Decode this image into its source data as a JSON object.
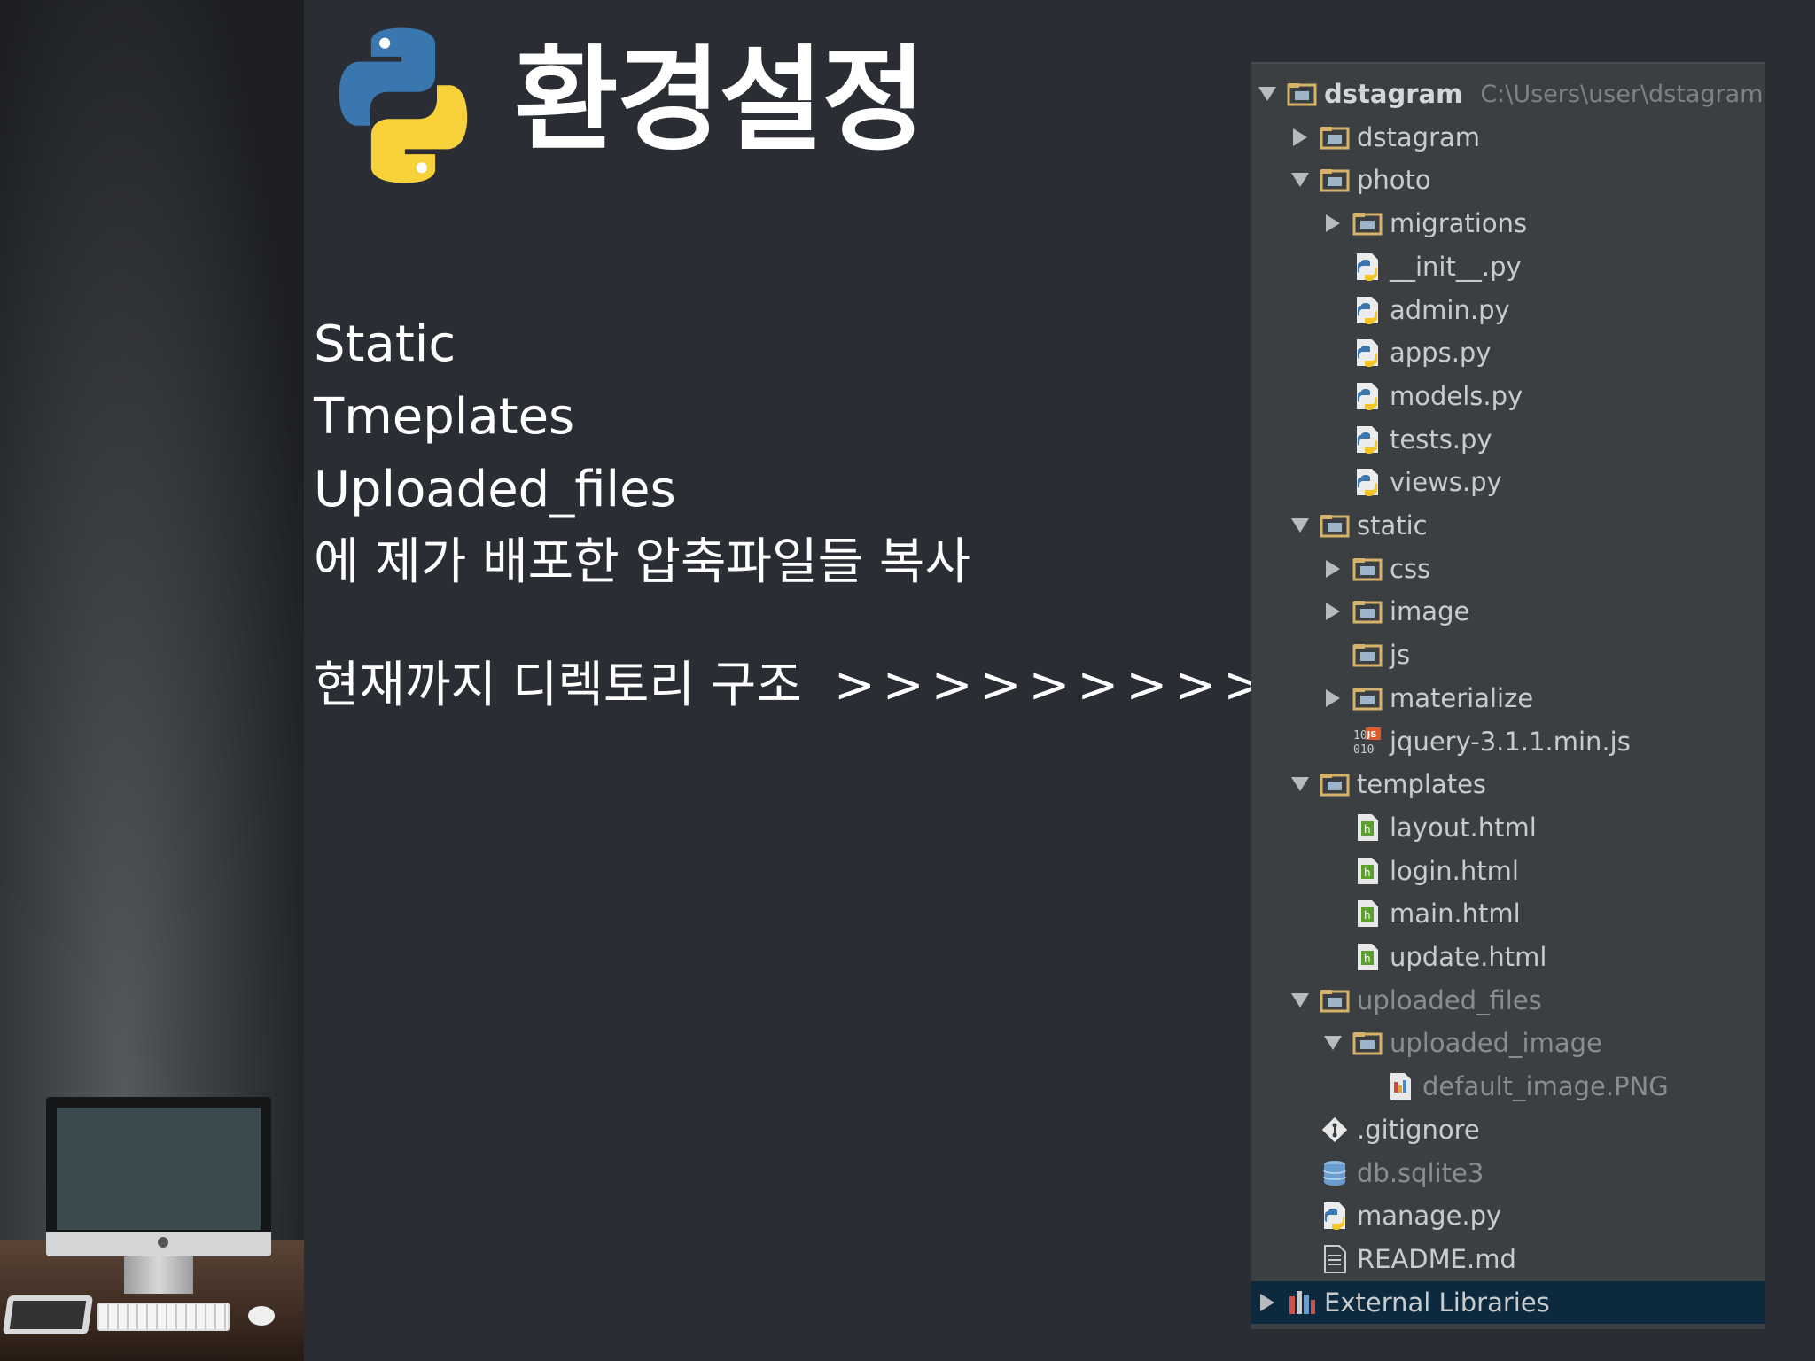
{
  "slide": {
    "title": "환경설정",
    "lines": [
      "Static",
      "Tmeplates",
      "Uploaded_files",
      "에 제가 배포한 압축파일들 복사"
    ],
    "structure_label": "현재까지 디렉토리 구조",
    "structure_arrows": ">>>>>>>>>"
  },
  "tree": {
    "root": {
      "label": "dstagram",
      "path": "C:\\Users\\user\\dstagram"
    },
    "items": [
      {
        "label": "dstagram",
        "icon": "folder-icon"
      },
      {
        "label": "photo",
        "icon": "folder-icon"
      },
      {
        "label": "migrations",
        "icon": "folder-icon"
      },
      {
        "label": "__init__.py",
        "icon": "python-file-icon"
      },
      {
        "label": "admin.py",
        "icon": "python-file-icon"
      },
      {
        "label": "apps.py",
        "icon": "python-file-icon"
      },
      {
        "label": "models.py",
        "icon": "python-file-icon"
      },
      {
        "label": "tests.py",
        "icon": "python-file-icon"
      },
      {
        "label": "views.py",
        "icon": "python-file-icon"
      },
      {
        "label": "static",
        "icon": "folder-icon"
      },
      {
        "label": "css",
        "icon": "folder-icon"
      },
      {
        "label": "image",
        "icon": "folder-icon"
      },
      {
        "label": "js",
        "icon": "folder-icon"
      },
      {
        "label": "materialize",
        "icon": "folder-icon"
      },
      {
        "label": "jquery-3.1.1.min.js",
        "icon": "js-file-icon"
      },
      {
        "label": "templates",
        "icon": "folder-icon"
      },
      {
        "label": "layout.html",
        "icon": "html-file-icon"
      },
      {
        "label": "login.html",
        "icon": "html-file-icon"
      },
      {
        "label": "main.html",
        "icon": "html-file-icon"
      },
      {
        "label": "update.html",
        "icon": "html-file-icon"
      },
      {
        "label": "uploaded_files",
        "icon": "folder-icon"
      },
      {
        "label": "uploaded_image",
        "icon": "folder-icon"
      },
      {
        "label": "default_image.PNG",
        "icon": "image-file-icon"
      },
      {
        "label": ".gitignore",
        "icon": "git-icon"
      },
      {
        "label": "db.sqlite3",
        "icon": "database-icon"
      },
      {
        "label": "manage.py",
        "icon": "python-file-icon"
      },
      {
        "label": "README.md",
        "icon": "text-file-icon"
      },
      {
        "label": "External Libraries",
        "icon": "library-icon"
      }
    ]
  }
}
